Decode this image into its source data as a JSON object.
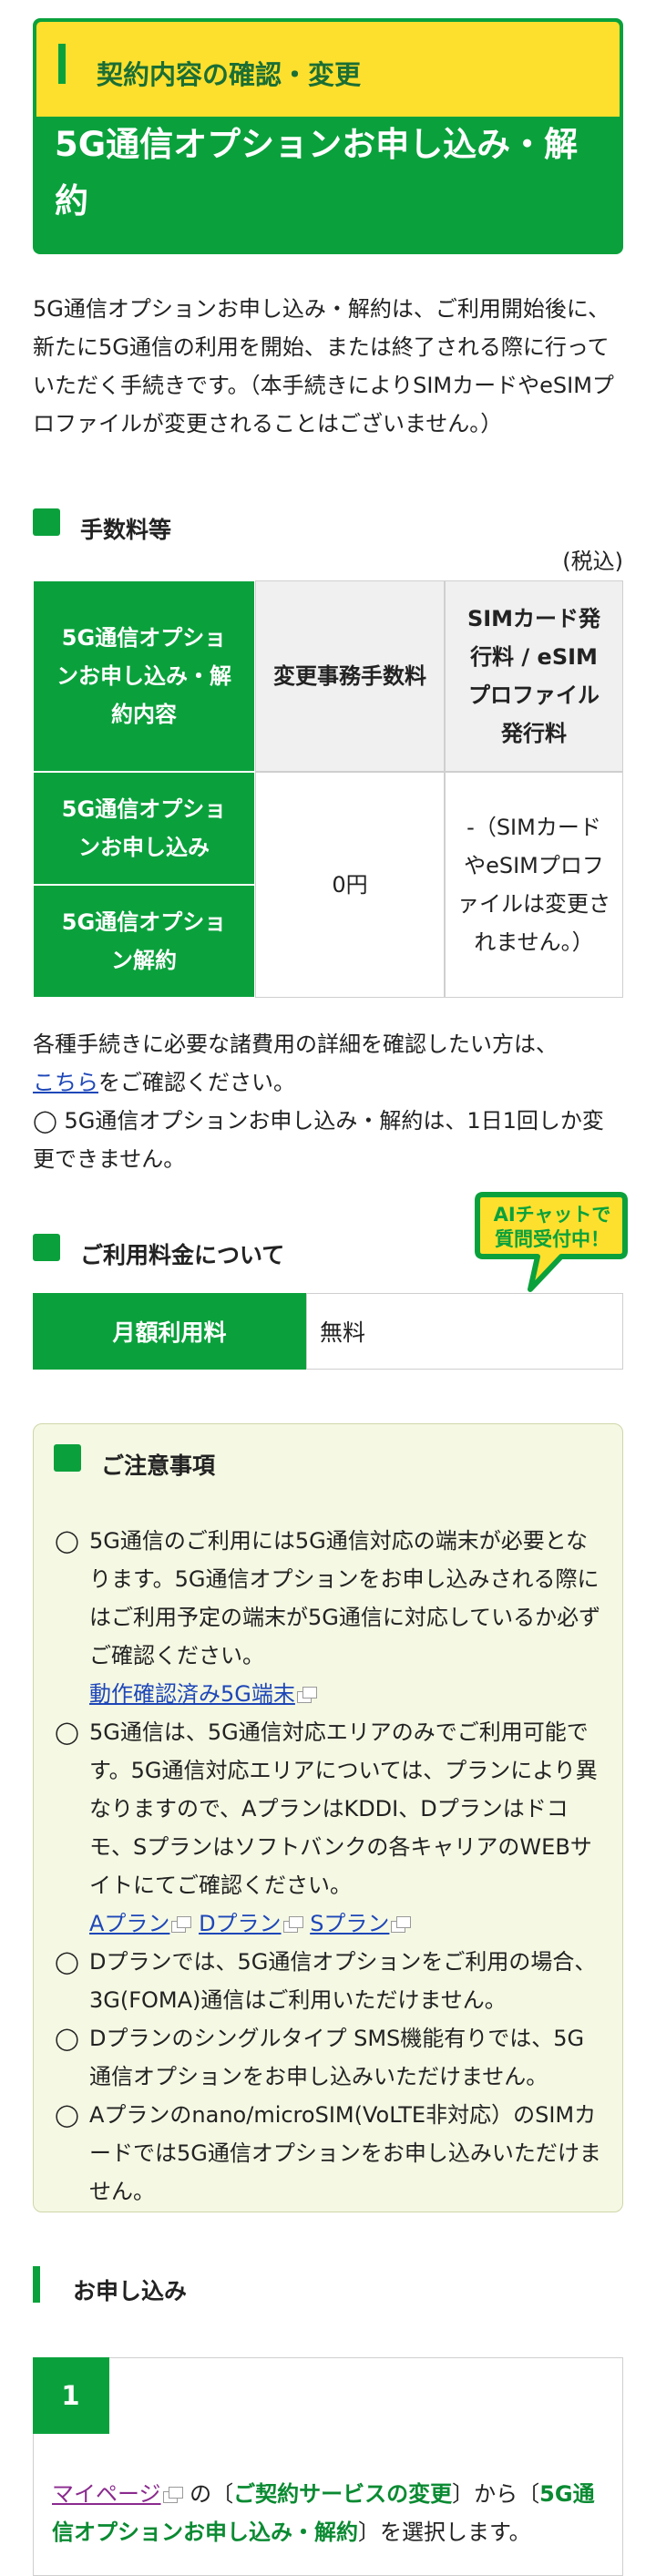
{
  "header": {
    "category": "契約内容の確認・変更",
    "title": "5G通信オプションお申し込み・解約"
  },
  "intro": "5G通信オプションお申し込み・解約は、ご利用開始後に、新たに5G通信の利用を開始、または終了される際に行っていただく手続きです。（本手続きによりSIMカードやeSIMプロファイルが変更されることはございません。）",
  "fees": {
    "heading": "手数料等",
    "tax_note": "(税込)",
    "table": {
      "col0": "5G通信オプションお申し込み・解約内容",
      "col1": "変更事務手数料",
      "col2": "SIMカード発行料 / eSIMプロファイル発行料",
      "row1": "5G通信オプションお申し込み",
      "row2": "5G通信オプション解約",
      "fee": "0円",
      "sim_fee": "-（SIMカードやeSIMプロファイルは変更されません。）"
    },
    "detail_prefix": "各種手続きに必要な諸費用の詳細を確認したい方は、",
    "detail_link": "こちら",
    "detail_suffix": "をご確認ください。",
    "limit_note": "◯ 5G通信オプションお申し込み・解約は、1日1回しか変更できません。"
  },
  "pricing": {
    "heading": "ご利用料金について",
    "ai_badge_line1": "AIチャットで",
    "ai_badge_line2": "質問受付中！",
    "monthly_label": "月額利用料",
    "monthly_value": "無料"
  },
  "notes": {
    "heading": "ご注意事項",
    "items": [
      {
        "mark": "◯",
        "text": "5G通信のご利用には5G通信対応の端末が必要となります。5G通信オプションをお申し込みされる際にはご利用予定の端末が5G通信に対応しているか必ずご確認ください。",
        "links": [
          "動作確認済み5G端末"
        ]
      },
      {
        "mark": "◯",
        "text": "5G通信は、5G通信対応エリアのみでご利用可能です。5G通信対応エリアについては、プランにより異なりますので、AプランはKDDI、Dプランはドコモ、Sプランはソフトバンクの各キャリアのWEBサイトにてご確認ください。",
        "links": [
          "Aプラン",
          "Dプラン",
          "Sプラン"
        ]
      },
      {
        "mark": "◯",
        "text": "Dプランでは、5G通信オプションをご利用の場合、3G(FOMA)通信はご利用いただけません。"
      },
      {
        "mark": "◯",
        "text": "Dプランのシングルタイプ SMS機能有りでは、5G通信オプションをお申し込みいただけません。"
      },
      {
        "mark": "◯",
        "text": "Aプランのnano/microSIM(VoLTE非対応）のSIMカードでは5G通信オプションをお申し込みいただけません。"
      }
    ]
  },
  "apply": {
    "heading": "お申し込み",
    "step_number": "1",
    "mypage_link": "マイページ",
    "text_a": " の〔",
    "menu1": "ご契約サービスの変更",
    "text_b": "〕から〔",
    "menu2": "5G通信オプションお申し込み・解約",
    "text_c": "〕を選択します。"
  },
  "colors": {
    "green": "#0aa13c",
    "yellow": "#fde02e",
    "link": "#1e47b8",
    "notes_bg": "#f5f8e3"
  }
}
